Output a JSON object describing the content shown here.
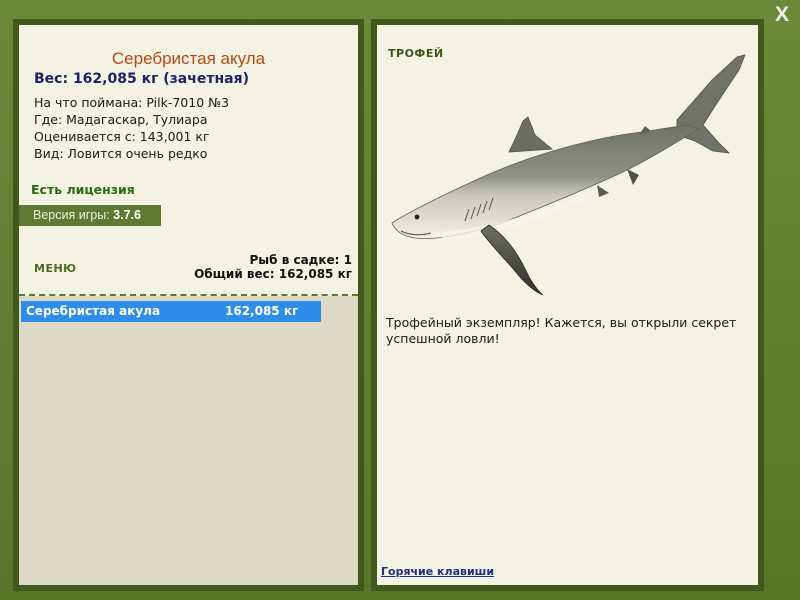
{
  "window": {
    "close_label": "X"
  },
  "fish": {
    "name": "Серебристая акула",
    "weight_line": "Вес: 162,085 кг (зачетная)",
    "details": [
      "На что поймана: Pilk-7010 №3",
      "Где: Мадагаскар, Тулиара",
      "Оценивается с: 143,001 кг",
      "Вид: Ловится очень редко"
    ]
  },
  "license_label": "Есть лицензия",
  "version": {
    "label": "Версия игры: ",
    "value": "3.7.6"
  },
  "menu_label": "МЕНЮ",
  "keepnet": {
    "count_line": "Рыб в садке: 1",
    "total_line": "Общий вес: 162,085 кг"
  },
  "catch_list": [
    {
      "name": "Серебристая акула",
      "weight": "162,085 кг"
    }
  ],
  "trophy": {
    "heading": "ТРОФЕЙ",
    "image": "silky-shark",
    "description": "Трофейный экземпляр! Кажется, вы открыли секрет успешной ловли!"
  },
  "hotkeys_label": "Горячие клавиши",
  "colors": {
    "frame": "#5b7a30",
    "panel_border": "#41591c",
    "panel_bg": "#f4f2e3",
    "list_bg": "#dcd9c5",
    "title": "#b54814",
    "weight": "#1b2468",
    "license": "#2a6b12",
    "selection": "#2e8de8",
    "link": "#1e2d8a"
  }
}
